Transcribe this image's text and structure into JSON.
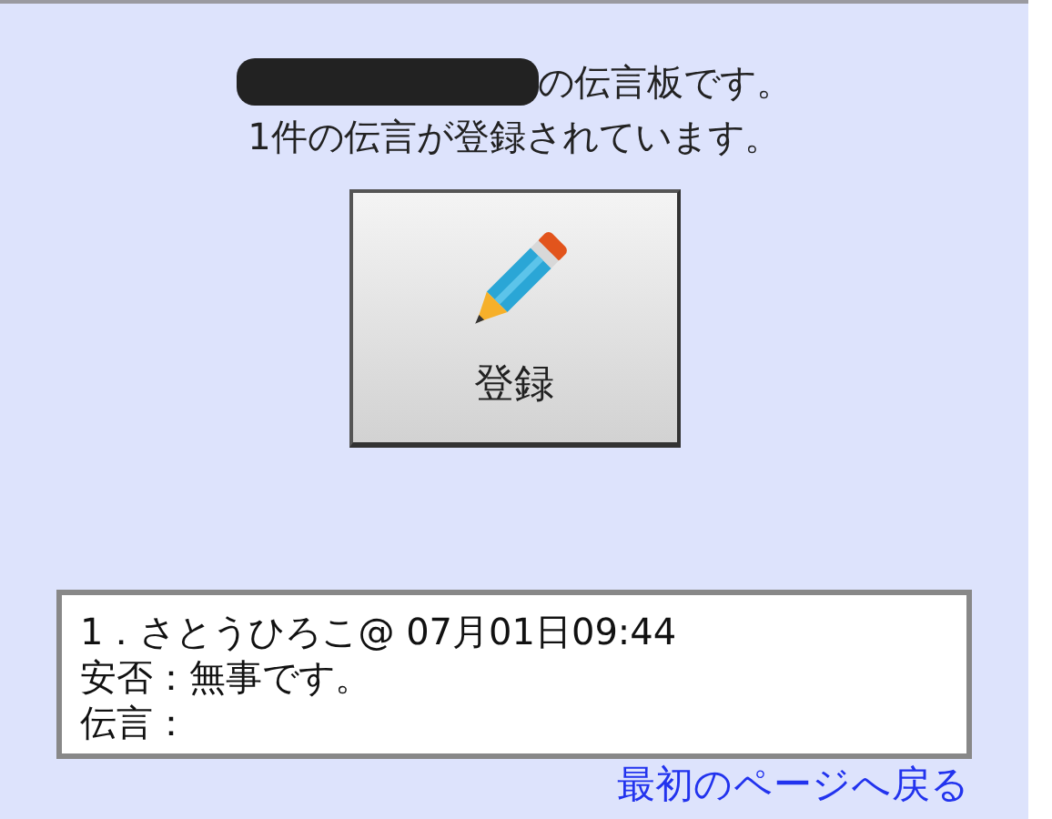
{
  "header": {
    "title_suffix": "の伝言板です。",
    "count_line": "1件の伝言が登録されています。"
  },
  "register_button": {
    "label": "登録"
  },
  "messages": [
    {
      "lines": [
        "1．さとうひろこ@ 07月01日09:44",
        "安否：無事です。",
        "伝言："
      ]
    }
  ],
  "back_link": "最初のページへ戻る"
}
